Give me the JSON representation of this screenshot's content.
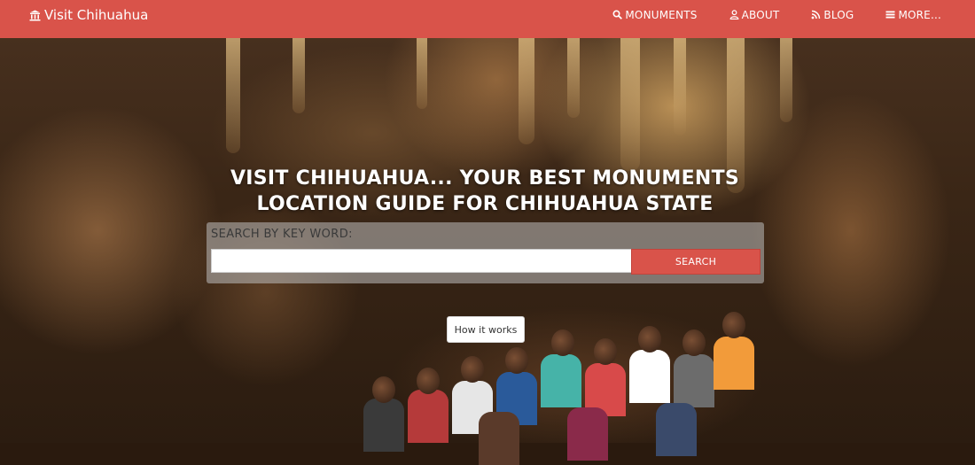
{
  "brand": {
    "title": "Visit Chihuahua",
    "icon": "bank-icon"
  },
  "nav": {
    "items": [
      {
        "label": "MONUMENTS",
        "icon": "search-icon"
      },
      {
        "label": "ABOUT",
        "icon": "user-icon"
      },
      {
        "label": "BLOG",
        "icon": "rss-icon"
      },
      {
        "label": "MORE...",
        "icon": "menu-icon"
      }
    ]
  },
  "hero": {
    "headline_line1": "VISIT CHIHUAHUA... YOUR BEST MONUMENTS",
    "headline_line2": "LOCATION GUIDE FOR CHIHUAHUA STATE",
    "background": "cave-photo"
  },
  "search": {
    "label": "SEARCH BY KEY WORD:",
    "value": "",
    "placeholder": "",
    "button_label": "SEARCH"
  },
  "how_it_works": {
    "label": "How it works"
  },
  "colors": {
    "accent": "#d9534a",
    "navbar_text": "#ffffff"
  }
}
